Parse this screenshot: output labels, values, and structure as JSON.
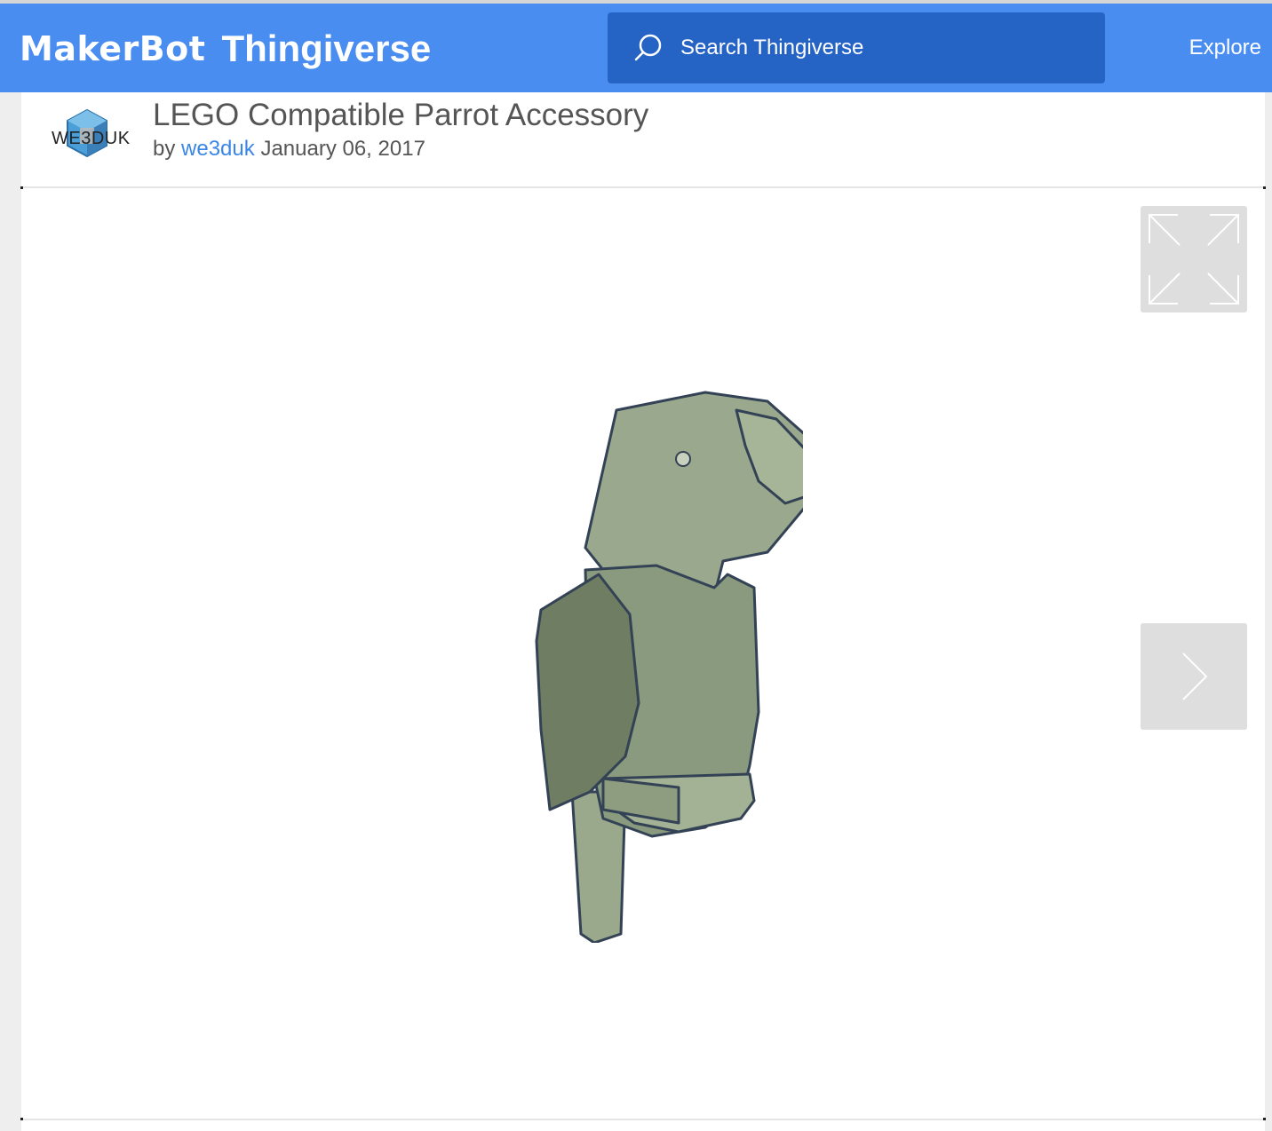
{
  "header": {
    "logo_maker": "MakerBot",
    "logo_thingiverse": "Thingiverse",
    "search_placeholder": "Search Thingiverse",
    "explore_label": "Explore"
  },
  "thing": {
    "avatar_text": "WE3DUK",
    "title": "LEGO Compatible Parrot Accessory",
    "by_label": "by",
    "author": "we3duk",
    "date": "January 06, 2017"
  },
  "viewer": {
    "expand_icon": "expand-icon",
    "next_icon": "chevron-right-icon"
  },
  "colors": {
    "header_bg": "#4a8df0",
    "search_bg": "#2563c5",
    "link": "#3b86e6",
    "model": "#8a9a7e"
  }
}
